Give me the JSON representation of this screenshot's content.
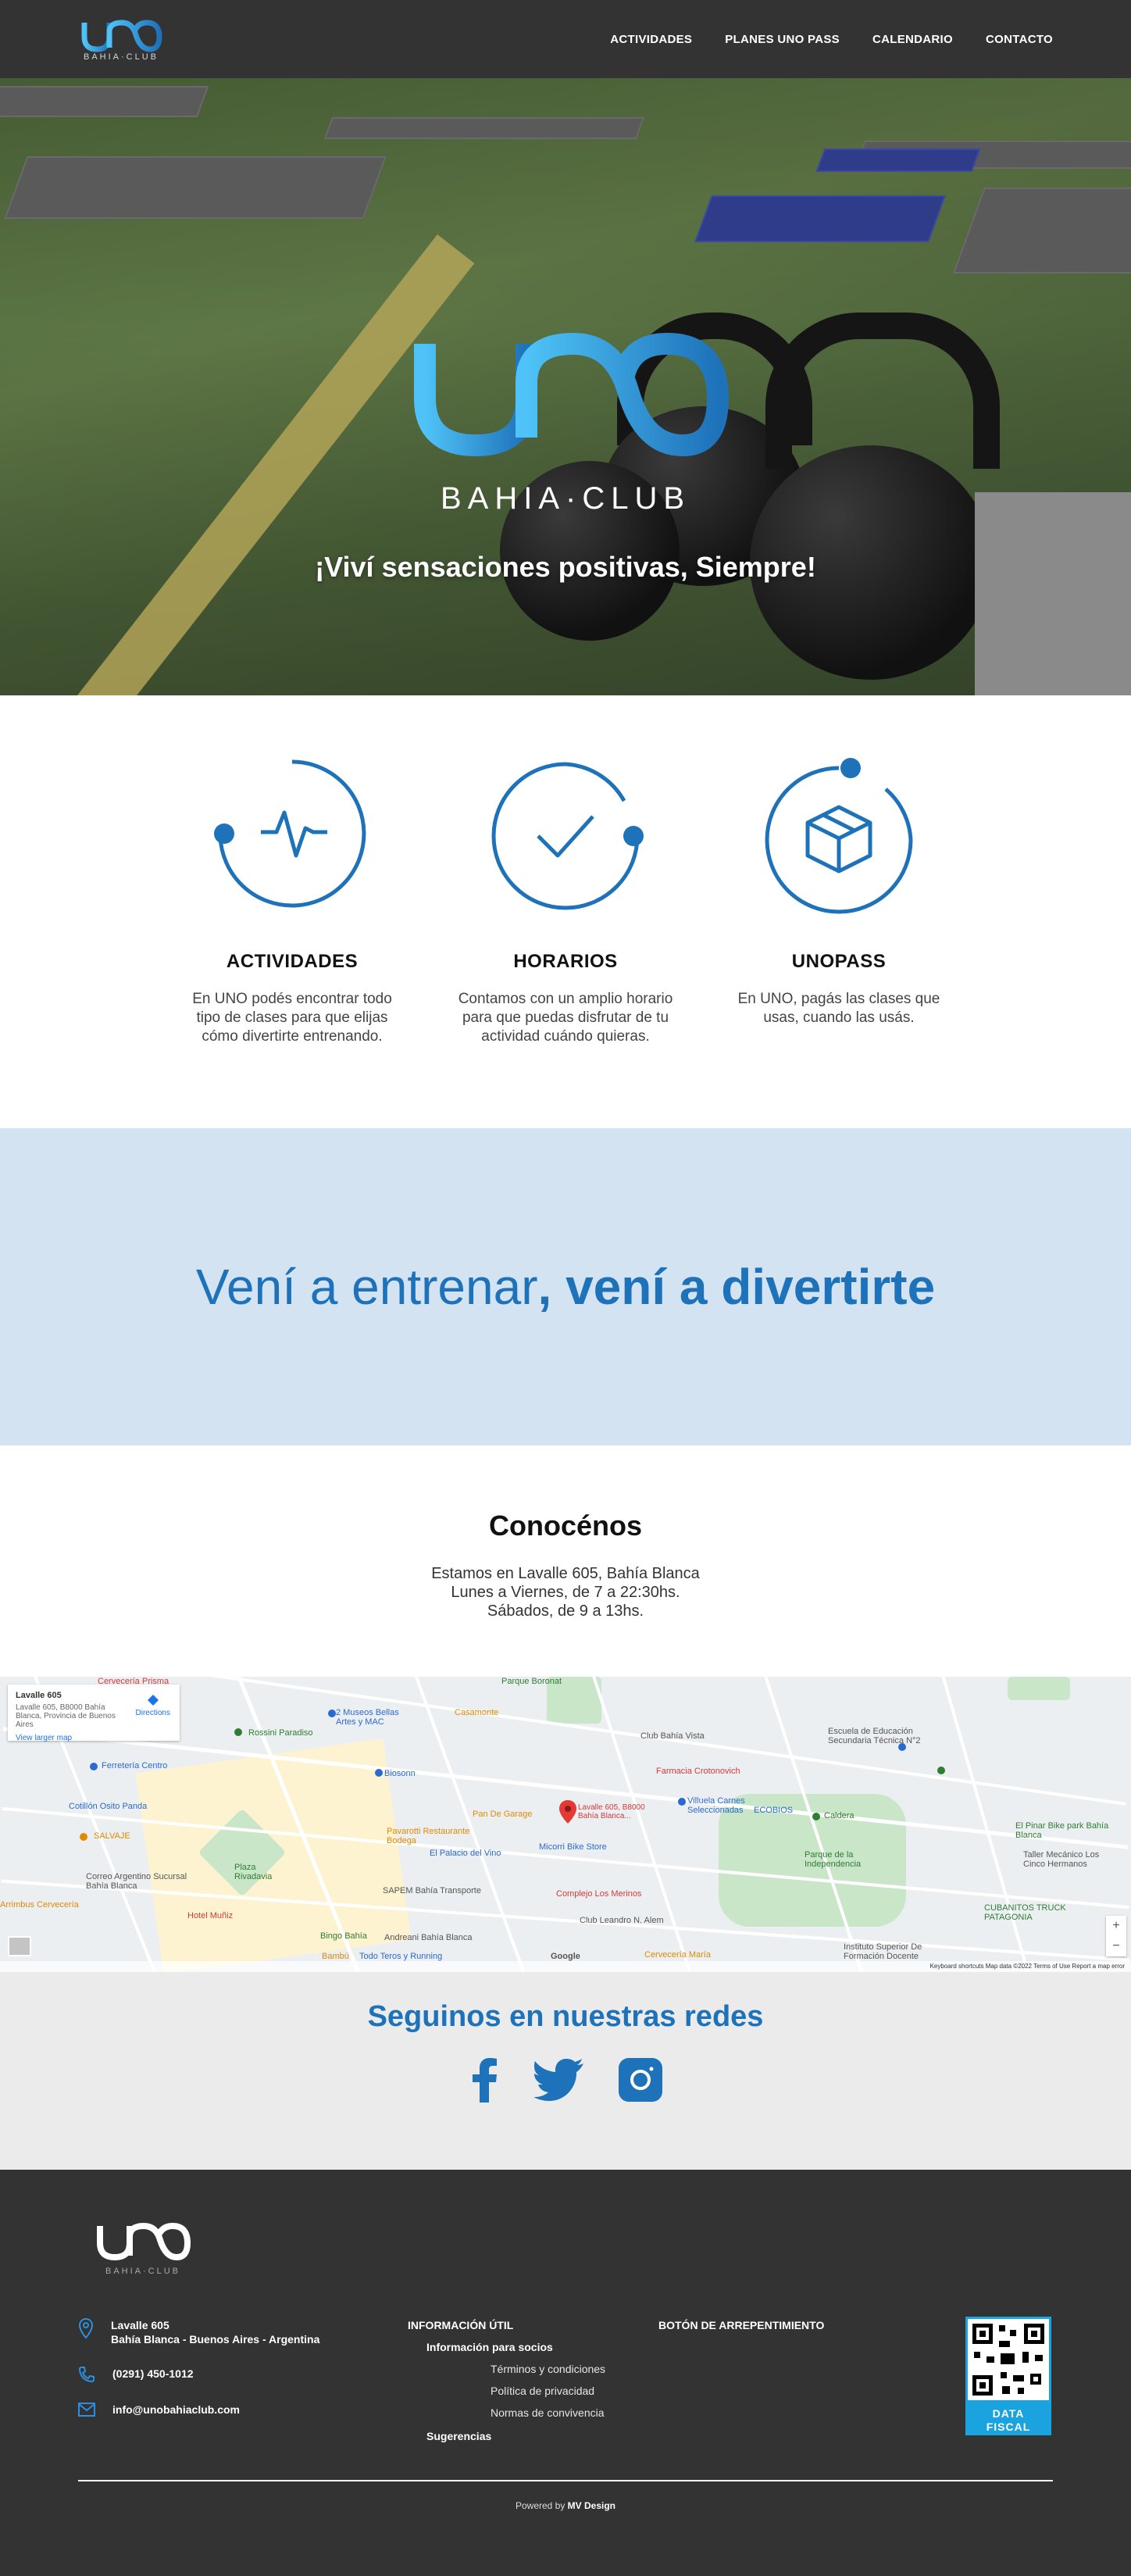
{
  "colors": {
    "brand_blue": "#1e72b9",
    "dark": "#333333",
    "banner_bg": "#d3e3f1",
    "social_bg": "#ebebeb"
  },
  "brand": {
    "logo_text": "UNO",
    "logo_sub": "BAHIA·CLUB"
  },
  "nav": {
    "items": [
      "ACTIVIDADES",
      "PLANES UNO PASS",
      "CALENDARIO",
      "CONTACTO"
    ]
  },
  "hero": {
    "slogan": "¡Viví sensaciones positivas, Siempre!"
  },
  "features": [
    {
      "icon": "activity-pulse-icon",
      "title": "ACTIVIDADES",
      "text": "En UNO podés encontrar todo tipo de clases para que elijas cómo divertirte entrenando."
    },
    {
      "icon": "check-icon",
      "title": "HORARIOS",
      "text": "Contamos con un amplio horario para que puedas disfrutar de tu actividad cuándo quieras."
    },
    {
      "icon": "box-icon",
      "title": "UNOPASS",
      "text": "En UNO, pagás las clases que usas, cuando las usás."
    }
  ],
  "banner": {
    "light": "Vení a entrenar",
    "bold": ", vení a divertirte"
  },
  "about": {
    "title": "Conocénos",
    "lines": [
      "Estamos en Lavalle 605, Bahía Blanca",
      "Lunes a Viernes, de 7 a 22:30hs.",
      "Sábados, de 9 a 13hs."
    ]
  },
  "map": {
    "card_title": "Lavalle 605",
    "card_address": "Lavalle 605, B8000 Bahía Blanca, Provincia de Buenos Aires",
    "card_link": "View larger map",
    "card_directions": "Directions",
    "marker_label": "Lavalle 605, B8000 Bahía Blanca...",
    "places": [
      "Parque Boronat",
      "Cervecería Prisma",
      "Rossini Paradiso",
      "2 Museos Bellas Artes y MAC",
      "Casamonte",
      "Club Bahía Vista",
      "Ferretería Centro",
      "Biosonn",
      "Farmacia Crotonovich",
      "Escuela de Educación Secundaria Técnica N°2",
      "Cotillón Osito Panda",
      "Pan De Garage",
      "Villuela Carnes Seleccionadas",
      "ECOBIOS",
      "Caldera",
      "SALVAJE",
      "Plaza Rivadavia",
      "Pavarotti Restaurante Bodega",
      "El Palacio del Vino",
      "Micorri Bike Store",
      "Parque de la Independencia",
      "El Pinar Bike park Bahía Blanca",
      "Taller Mecánico Los Cinco Hermanos",
      "Correo Argentino Sucursal Bahía Blanca",
      "SAPEM Bahía Transporte",
      "Complejo Los Merinos",
      "Club Leandro N. Alem",
      "CUBANITOS TRUCK PATAGONIA",
      "Hotel Muñiz",
      "Andreani Bahía Blanca",
      "Bingo Bahía",
      "Cervecería María",
      "Instituto Superior De Formación Docente",
      "Bambú",
      "Todo Teros y Running",
      "Arrimbus Cervecería"
    ],
    "google": "Google",
    "footer": "Keyboard shortcuts   Map data ©2022   Terms of Use   Report a map error",
    "zoom_in": "+",
    "zoom_out": "−"
  },
  "social": {
    "title": "Seguinos en nuestras redes",
    "icons": [
      "facebook-icon",
      "twitter-icon",
      "instagram-icon"
    ]
  },
  "footer": {
    "address_line1": "Lavalle 605",
    "address_line2": "Bahía Blanca - Buenos Aires - Argentina",
    "phone": "(0291) 450-1012",
    "email": "info@unobahiaclub.com",
    "info_title": "INFORMACIÓN ÚTIL",
    "info_sub": "Información para socios",
    "links": [
      "Términos y condiciones",
      "Política de privacidad",
      "Normas de convivencia"
    ],
    "suggestions": "Sugerencias",
    "regret_button": "BOTÓN DE ARREPENTIMIENTO",
    "data_fiscal": [
      "DATA",
      "FISCAL"
    ],
    "powered_prefix": "Powered by ",
    "powered_by": "MV Design"
  }
}
